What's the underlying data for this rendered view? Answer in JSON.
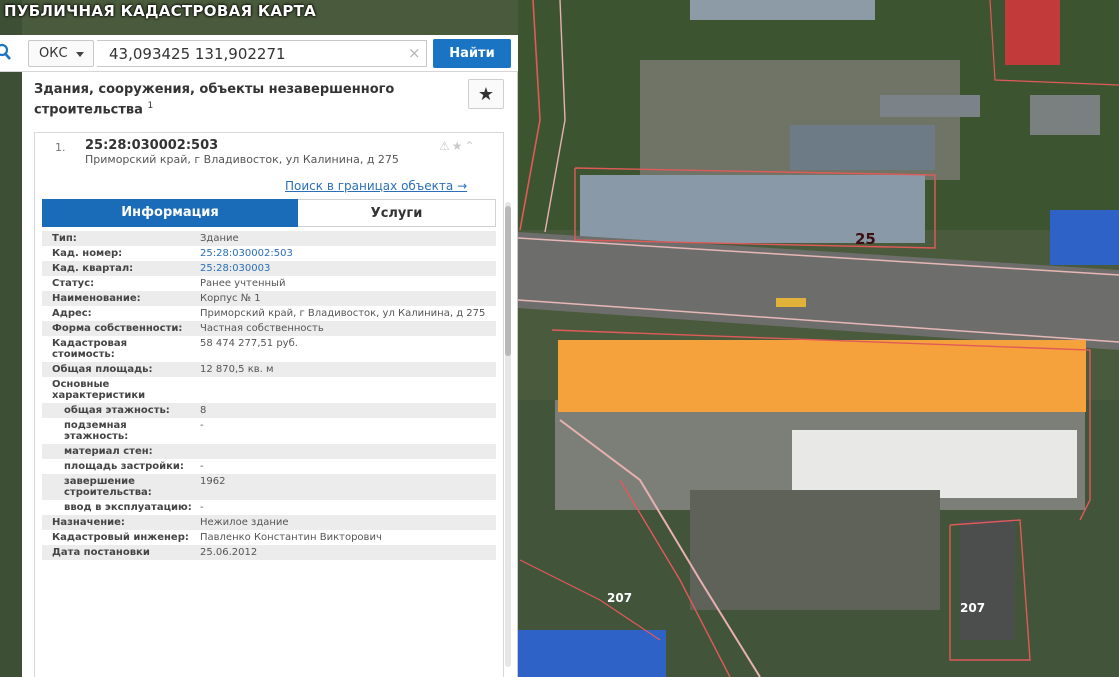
{
  "app": {
    "title": "ПУБЛИЧНАЯ КАДАСТРОВАЯ КАРТА"
  },
  "search": {
    "type_value": "ОКС",
    "query": "43,093425 131,902271",
    "clear_symbol": "×",
    "submit_label": "Найти"
  },
  "panel": {
    "category_title": "Здания, сооружения, объекты незавершенного строительства",
    "category_footnote": "1",
    "favorite_symbol": "★",
    "result": {
      "index": "1.",
      "cadastral_number": "25:28:030002:503",
      "address": "Приморский край, г Владивосток, ул Калинина, д 275",
      "tools_symbols": "⚠★⌃",
      "bounds_link": "Поиск в границах объекта →"
    },
    "tabs": {
      "info": "Информация",
      "services": "Услуги"
    },
    "properties": [
      {
        "label": "Тип:",
        "value": "Здание"
      },
      {
        "label": "Кад. номер:",
        "value": "25:28:030002:503",
        "link": true
      },
      {
        "label": "Кад. квартал:",
        "value": "25:28:030003",
        "link": true
      },
      {
        "label": "Статус:",
        "value": "Ранее учтенный"
      },
      {
        "label": "Наименование:",
        "value": "Корпус № 1"
      },
      {
        "label": "Адрес:",
        "value": "Приморский край, г Владивосток, ул Калинина, д 275"
      },
      {
        "label": "Форма собственности:",
        "value": "Частная собственность"
      },
      {
        "label": "Кадастровая стоимость:",
        "value": "58 474 277,51 руб."
      },
      {
        "label": "Общая площадь:",
        "value": "12 870,5 кв. м"
      },
      {
        "label": "Основные характеристики",
        "value": ""
      },
      {
        "label": "общая этажность:",
        "value": "8",
        "sub": true
      },
      {
        "label": "подземная этажность:",
        "value": "-",
        "sub": true
      },
      {
        "label": "материал стен:",
        "value": "",
        "sub": true
      },
      {
        "label": "площадь застройки:",
        "value": "-",
        "sub": true
      },
      {
        "label": "завершение строительства:",
        "value": "1962",
        "sub": true
      },
      {
        "label": "ввод в эксплуатацию:",
        "value": "-",
        "sub": true
      },
      {
        "label": "Назначение:",
        "value": "Нежилое здание"
      },
      {
        "label": "Кадастровый инженер:",
        "value": "Павленко Константин Викторович"
      },
      {
        "label": "Дата постановки",
        "value": "25.06.2012"
      }
    ]
  },
  "map": {
    "labels": {
      "quarter_25": "25",
      "parcel_207_a": "207",
      "parcel_207_b": "207"
    },
    "colors": {
      "vegetation": "#3f5a2f",
      "road": "#7a7a78",
      "boundary": "#e05a5a",
      "highlight": "#f5a23c",
      "roof_gray": "#9aa3ab",
      "roof_blue": "#2f62c7",
      "roof_red": "#c23a3a"
    }
  }
}
